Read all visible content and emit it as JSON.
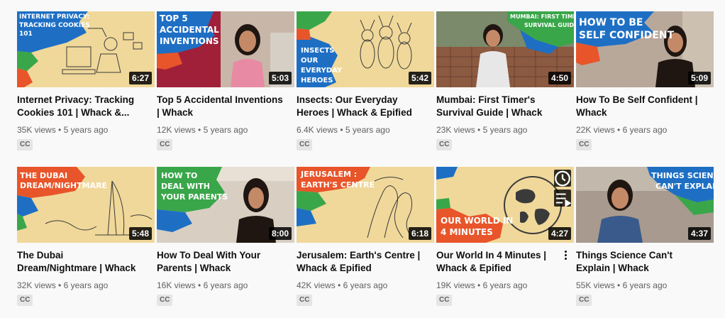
{
  "videos": [
    {
      "title": "Internet Privacy: Tracking Cookies 101 | Whack &...",
      "views": "35K views",
      "age": "5 years ago",
      "duration": "6:27",
      "badge": "CC",
      "thumb_text": [
        "INTERNET PRIVACY:",
        "TRACKING COOKIES",
        "101"
      ]
    },
    {
      "title": "Top 5 Accidental Inventions | Whack",
      "views": "12K views",
      "age": "5 years ago",
      "duration": "5:03",
      "badge": "CC",
      "thumb_text": [
        "TOP 5",
        "ACCIDENTAL",
        "INVENTIONS"
      ]
    },
    {
      "title": "Insects: Our Everyday Heroes | Whack & Epified",
      "views": "6.4K views",
      "age": "5 years ago",
      "duration": "5:42",
      "badge": "CC",
      "thumb_text": [
        "INSECTS",
        "OUR",
        "EVERYDAY",
        "HEROES"
      ]
    },
    {
      "title": "Mumbai: First Timer's Survival Guide | Whack",
      "views": "23K views",
      "age": "5 years ago",
      "duration": "4:50",
      "badge": "CC",
      "thumb_text": [
        "MUMBAI: FIRST TIMER'S",
        "SURVIVAL GUIDE"
      ]
    },
    {
      "title": "How To Be Self Confident | Whack",
      "views": "22K views",
      "age": "6 years ago",
      "duration": "5:09",
      "badge": "CC",
      "thumb_text": [
        "HOW TO BE",
        "SELF CONFIDENT"
      ]
    },
    {
      "title": "The Dubai Dream/Nightmare | Whack & Epified",
      "views": "32K views",
      "age": "6 years ago",
      "duration": "5:48",
      "badge": "CC",
      "thumb_text": [
        "THE DUBAI",
        "DREAM/NIGHTMARE"
      ]
    },
    {
      "title": "How To Deal With Your Parents | Whack",
      "views": "16K views",
      "age": "6 years ago",
      "duration": "8:00",
      "badge": "CC",
      "thumb_text": [
        "HOW TO",
        "DEAL WITH",
        "YOUR PARENTS"
      ]
    },
    {
      "title": "Jerusalem: Earth's Centre | Whack & Epified",
      "views": "42K views",
      "age": "6 years ago",
      "duration": "6:18",
      "badge": "CC",
      "thumb_text": [
        "JERUSALEM :",
        "EARTH'S CENTRE"
      ]
    },
    {
      "title": "Our World In 4 Minutes | Whack & Epified",
      "views": "19K views",
      "age": "6 years ago",
      "duration": "4:27",
      "badge": "CC",
      "thumb_text": [
        "OUR WORLD IN",
        "4 MINUTES"
      ]
    },
    {
      "title": "Things Science Can't Explain | Whack",
      "views": "55K views",
      "age": "6 years ago",
      "duration": "4:37",
      "badge": "CC",
      "thumb_text": [
        "THINGS SCIENCE",
        "CAN'T EXPLAIN"
      ]
    }
  ],
  "meta_separator": "•",
  "colors": {
    "paper": "#f0d89a",
    "blue": "#1e6fc4",
    "green": "#3aa64a",
    "orange": "#e8552a",
    "room": "#b8a89a"
  },
  "icons": {
    "watch_later": "clock-icon",
    "add_to_queue": "queue-icon",
    "more": "more-vert-icon"
  }
}
